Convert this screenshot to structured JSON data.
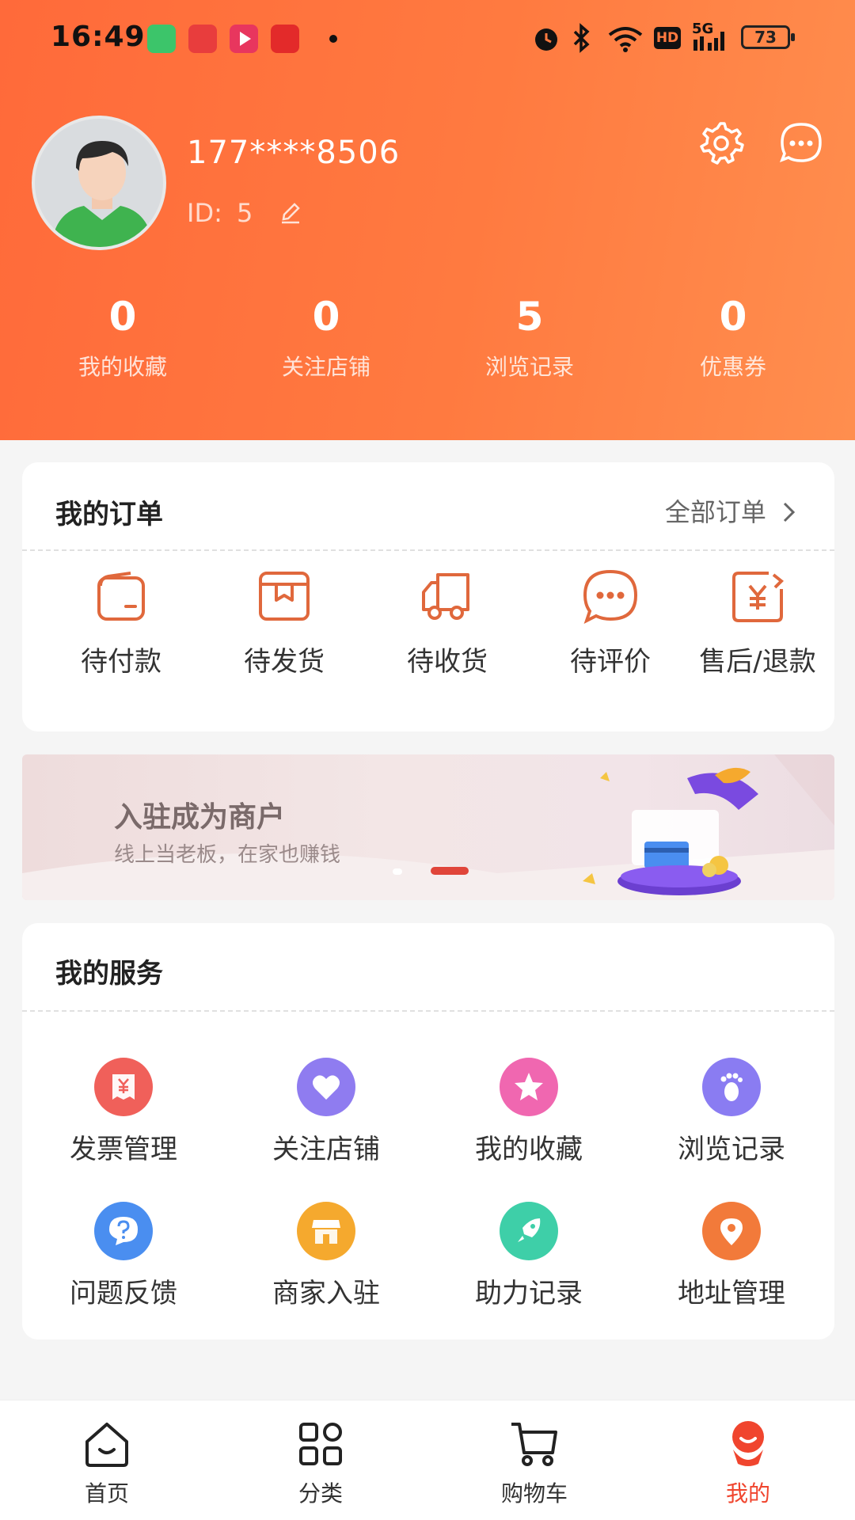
{
  "status_bar": {
    "time": "16:49",
    "network": "5G",
    "hd": "HD",
    "battery": "73"
  },
  "profile": {
    "phone": "177****8506",
    "id_label": "ID:",
    "id_value": "5"
  },
  "stats": [
    {
      "value": "0",
      "label": "我的收藏"
    },
    {
      "value": "0",
      "label": "关注店铺"
    },
    {
      "value": "5",
      "label": "浏览记录"
    },
    {
      "value": "0",
      "label": "优惠券"
    }
  ],
  "orders": {
    "title": "我的订单",
    "all_link": "全部订单",
    "items": [
      {
        "label": "待付款",
        "icon": "wallet-icon"
      },
      {
        "label": "待发货",
        "icon": "package-icon"
      },
      {
        "label": "待收货",
        "icon": "truck-icon"
      },
      {
        "label": "待评价",
        "icon": "comment-icon"
      },
      {
        "label": "售后/退款",
        "icon": "refund-icon"
      }
    ]
  },
  "banner": {
    "title": "入驻成为商户",
    "subtitle": "线上当老板，在家也赚钱"
  },
  "services": {
    "title": "我的服务",
    "items": [
      {
        "label": "发票管理",
        "icon": "invoice-icon",
        "color": "#f0605a"
      },
      {
        "label": "关注店铺",
        "icon": "heart-icon",
        "color": "#8f7cf0"
      },
      {
        "label": "我的收藏",
        "icon": "star-icon",
        "color": "#f067b0"
      },
      {
        "label": "浏览记录",
        "icon": "footprint-icon",
        "color": "#8a7cf2"
      },
      {
        "label": "问题反馈",
        "icon": "question-icon",
        "color": "#4a8ef0"
      },
      {
        "label": "商家入驻",
        "icon": "store-icon",
        "color": "#f5a92e"
      },
      {
        "label": "助力记录",
        "icon": "rocket-icon",
        "color": "#3ecfa8"
      },
      {
        "label": "地址管理",
        "icon": "location-icon",
        "color": "#f27a3a"
      }
    ]
  },
  "tabbar": [
    {
      "label": "首页",
      "icon": "home-icon"
    },
    {
      "label": "分类",
      "icon": "category-icon"
    },
    {
      "label": "购物车",
      "icon": "cart-icon"
    },
    {
      "label": "我的",
      "icon": "profile-icon",
      "active": true
    }
  ],
  "colors": {
    "accent": "#ff6a3a",
    "order_icon": "#e0683c",
    "active_tab": "#f0452e"
  }
}
